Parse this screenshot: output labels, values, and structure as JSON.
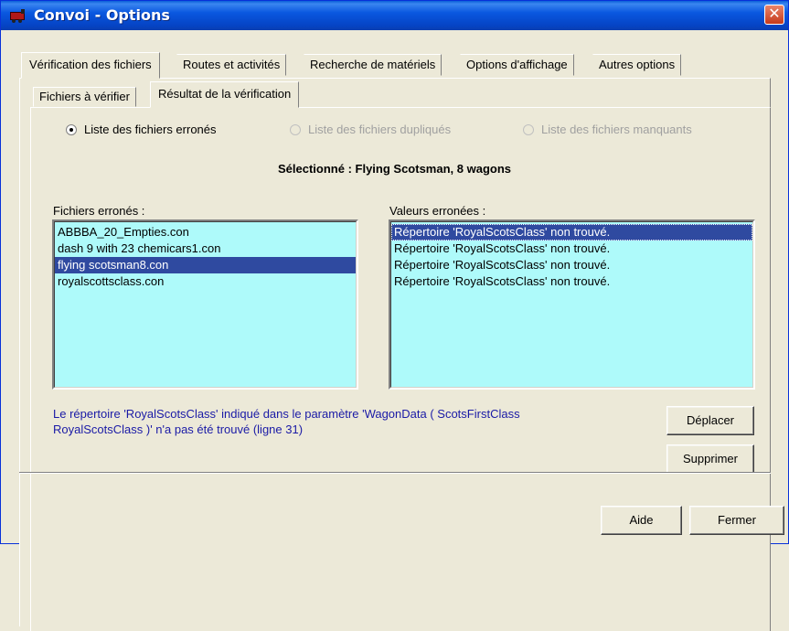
{
  "window": {
    "title": "Convoi - Options",
    "icon": "train-icon",
    "close_icon": "close-icon"
  },
  "main_tabs": [
    {
      "label": "Vérification des fichiers",
      "active": true
    },
    {
      "label": "Routes et activités",
      "active": false
    },
    {
      "label": "Recherche de matériels",
      "active": false
    },
    {
      "label": "Options d'affichage",
      "active": false
    },
    {
      "label": "Autres options",
      "active": false
    }
  ],
  "sub_tabs": [
    {
      "label": "Fichiers à vérifier",
      "active": false
    },
    {
      "label": "Résultat de la vérification",
      "active": true
    }
  ],
  "radios": [
    {
      "label": "Liste des fichiers erronés",
      "checked": true,
      "enabled": true
    },
    {
      "label": "Liste des fichiers dupliqués",
      "checked": false,
      "enabled": false
    },
    {
      "label": "Liste des fichiers manquants",
      "checked": false,
      "enabled": false
    }
  ],
  "selected_text": "Sélectionné : Flying Scotsman, 8 wagons",
  "files_list": {
    "label": "Fichiers erronés :",
    "items": [
      {
        "text": "ABBBA_20_Empties.con",
        "selected": false
      },
      {
        "text": "dash 9 with 23 chemicars1.con",
        "selected": false
      },
      {
        "text": "flying scotsman8.con",
        "selected": true
      },
      {
        "text": "royalscottsclass.con",
        "selected": false
      }
    ]
  },
  "values_list": {
    "label": "Valeurs erronées :",
    "items": [
      {
        "text": "Répertoire 'RoyalScotsClass' non trouvé.",
        "selected": true
      },
      {
        "text": "Répertoire 'RoyalScotsClass' non trouvé.",
        "selected": false
      },
      {
        "text": "Répertoire 'RoyalScotsClass' non trouvé.",
        "selected": false
      },
      {
        "text": "Répertoire 'RoyalScotsClass' non trouvé.",
        "selected": false
      }
    ]
  },
  "info": {
    "line1": "Le répertoire 'RoyalScotsClass' indiqué dans le paramètre 'WagonData ( ScotsFirstClass",
    "line2": "RoyalScotsClass )' n'a pas été trouvé (ligne 31)"
  },
  "buttons": {
    "move": "Déplacer",
    "delete": "Supprimer",
    "help": "Aide",
    "close": "Fermer"
  },
  "colors": {
    "title_bar": "#0a58e0",
    "list_background": "#aefafa",
    "selection": "#2f4aa0",
    "info_text": "#1a1aa6"
  }
}
